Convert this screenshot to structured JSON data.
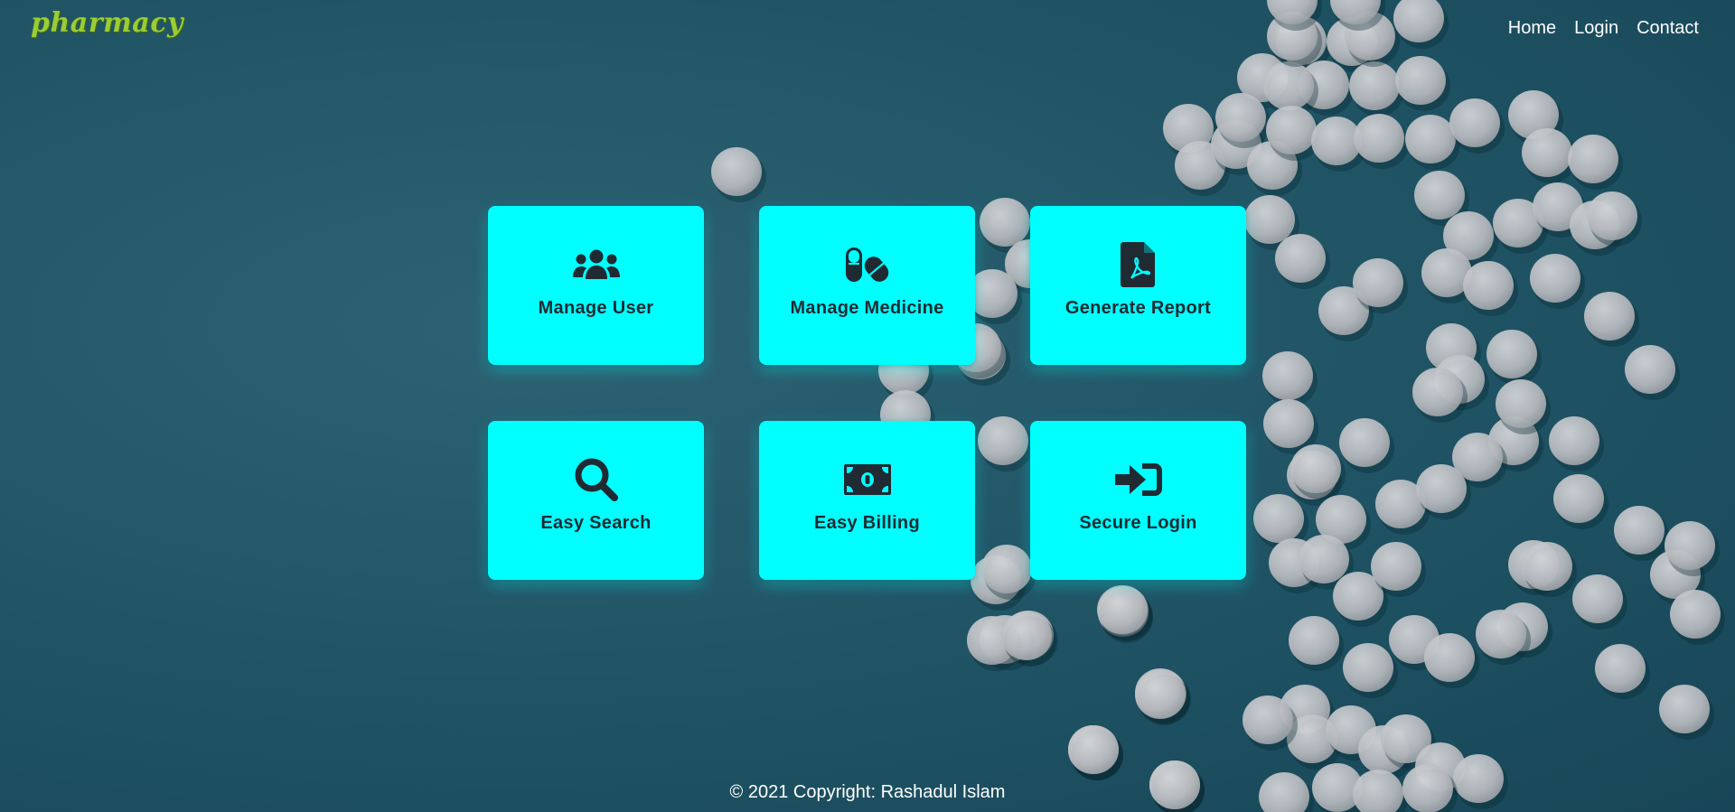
{
  "brand": {
    "name": "pharmacy",
    "color": "#9acd32"
  },
  "nav": {
    "links": [
      {
        "label": "Home"
      },
      {
        "label": "Login"
      },
      {
        "label": "Contact"
      }
    ]
  },
  "features": [
    {
      "label": "Manage User",
      "icon": "users-icon"
    },
    {
      "label": "Manage Medicine",
      "icon": "pills-icon"
    },
    {
      "label": "Generate Report",
      "icon": "pdf-file-icon"
    },
    {
      "label": "Easy Search",
      "icon": "search-icon"
    },
    {
      "label": "Easy Billing",
      "icon": "money-bill-icon"
    },
    {
      "label": "Secure Login",
      "icon": "sign-in-icon"
    }
  ],
  "footer": {
    "text": "© 2021 Copyright: Rashadul Islam"
  },
  "colors": {
    "card_background": "#00ffff",
    "card_text": "#1f2a33",
    "page_background": "#24596a"
  }
}
